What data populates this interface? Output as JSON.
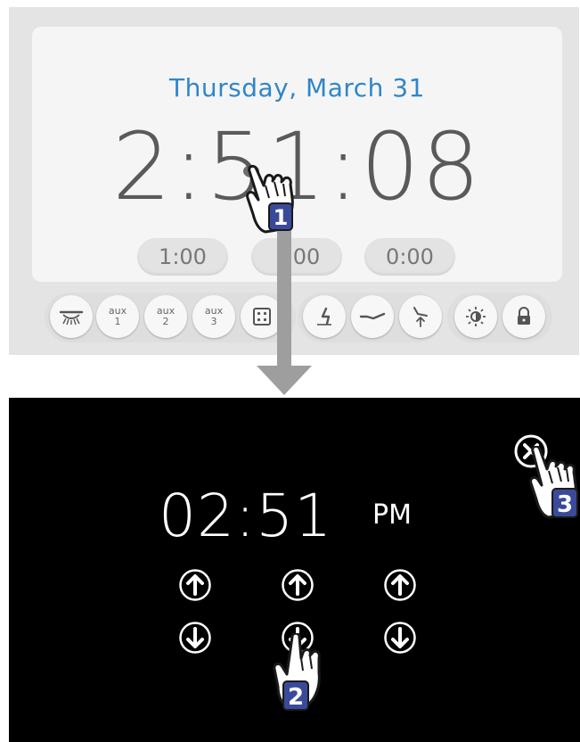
{
  "top": {
    "date": "Thursday, March 31",
    "time": "2:51:08",
    "timers": [
      "1:00",
      "00",
      "0:00"
    ]
  },
  "buttons": [
    {
      "name": "light-button",
      "icon": "operatory-light-icon"
    },
    {
      "name": "aux-1-button",
      "line1": "aux",
      "line2": "1"
    },
    {
      "name": "aux-2-button",
      "line1": "aux",
      "line2": "2"
    },
    {
      "name": "aux-3-button",
      "line1": "aux",
      "line2": "3"
    },
    {
      "name": "program-button",
      "icon": "dice-icon"
    },
    {
      "name": "chair-up-button",
      "icon": "chair-upright-icon"
    },
    {
      "name": "chair-flat-button",
      "icon": "chair-recline-icon"
    },
    {
      "name": "chair-return-button",
      "icon": "chair-return-icon"
    },
    {
      "name": "brightness-button",
      "icon": "brightness-icon"
    },
    {
      "name": "lock-button",
      "icon": "lock-icon"
    }
  ],
  "bottom": {
    "time": "02:51",
    "ampm": "PM"
  },
  "steps": {
    "step1": "1",
    "step2": "2",
    "step3": "3"
  },
  "colors": {
    "date": "#2f86c9",
    "step_badge": "#3a4a9a",
    "top_frame": "#e4e4e4",
    "bottom_panel": "#000000"
  }
}
